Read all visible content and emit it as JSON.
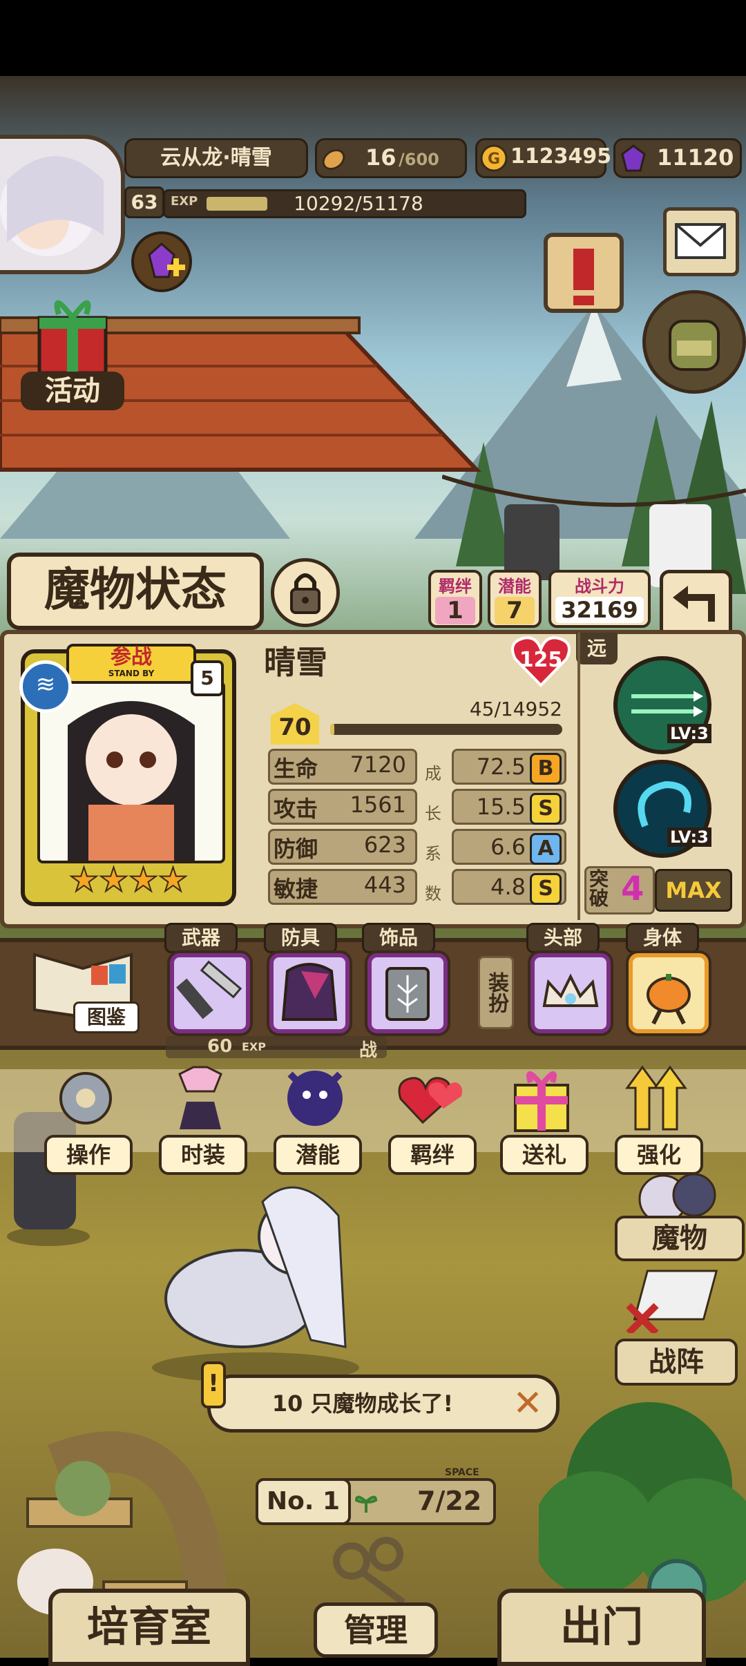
{
  "player": {
    "name": "云从龙·晴雪",
    "level": "63",
    "exp_label": "EXP",
    "exp": "10292/51178",
    "exp_progress": 0.201
  },
  "resources": {
    "stamina": "16",
    "stamina_max": "/600",
    "gold": "1123495",
    "gems": "11120"
  },
  "side": {
    "activity": "活动"
  },
  "status_title": "魔物状态",
  "tags": {
    "bond_label": "羁绊",
    "bond_value": "1",
    "potential_label": "潜能",
    "potential_value": "7",
    "power_label": "战斗力",
    "power_value": "32169"
  },
  "monster": {
    "name": "晴雪",
    "heart_level": "125",
    "standby_label": "参战",
    "standby_sub": "STAND BY",
    "rank_badge": "5",
    "stars": 4,
    "level": "70",
    "exp": "45/14952",
    "exp_progress": 0.003,
    "range": "远",
    "stats": [
      {
        "label": "生命",
        "value": "7120",
        "growth": "72.5",
        "grade": "B"
      },
      {
        "label": "攻击",
        "value": "1561",
        "growth": "15.5",
        "grade": "S"
      },
      {
        "label": "防御",
        "value": "623",
        "growth": "6.6",
        "grade": "A"
      },
      {
        "label": "敏捷",
        "value": "443",
        "growth": "4.8",
        "grade": "S"
      }
    ],
    "growth_chars": [
      "成",
      "长",
      "系",
      "数"
    ],
    "skills": [
      {
        "level": "LV:3"
      },
      {
        "level": "LV:3"
      }
    ],
    "breakthrough_label": "突破",
    "breakthrough_value": "4",
    "max_label": "MAX"
  },
  "equipment": {
    "codex": "图鉴",
    "slots": [
      {
        "label": "武器"
      },
      {
        "label": "防具"
      },
      {
        "label": "饰品"
      }
    ],
    "dress_label": "装扮",
    "dress_slots": [
      {
        "label": "头部"
      },
      {
        "label": "身体"
      }
    ]
  },
  "actions": [
    {
      "label": "操作",
      "icon": "gear-icon"
    },
    {
      "label": "时装",
      "icon": "outfit-icon"
    },
    {
      "label": "潜能",
      "icon": "potential-icon"
    },
    {
      "label": "羁绊",
      "icon": "hearts-icon"
    },
    {
      "label": "送礼",
      "icon": "gift-icon"
    },
    {
      "label": "强化",
      "icon": "arrow-up-icon"
    }
  ],
  "background_hint": {
    "level": "60",
    "exp_label": "EXP",
    "word": "战"
  },
  "side_buttons": {
    "monster": "魔物",
    "formation": "战阵"
  },
  "notification": "10 只魔物成长了!",
  "room": {
    "no": "No. 1",
    "space_label": "SPACE",
    "space": "7/22"
  },
  "bottom_nav": {
    "left": "培育室",
    "center": "管理",
    "right": "出门"
  }
}
